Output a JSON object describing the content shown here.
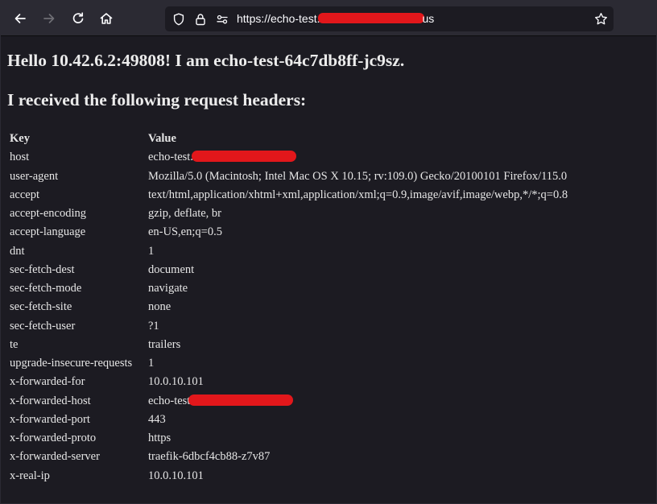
{
  "browser": {
    "url_visible_prefix": "https://echo-test.",
    "url_visible_suffix": "us",
    "icons": {
      "back": "arrow-left-icon",
      "forward": "arrow-right-icon",
      "reload": "reload-icon",
      "home": "home-icon",
      "tracking": "shield-icon",
      "lock": "lock-icon",
      "permissions": "permissions-icon",
      "bookmark": "star-icon"
    },
    "colors": {
      "toolbar": "#2b2a33",
      "urlbar": "#1c1b22",
      "page_bg": "#1c1b22",
      "redaction": "#e2171b"
    }
  },
  "page": {
    "greeting": "Hello 10.42.6.2:49808! I am echo-test-64c7db8ff-jc9sz.",
    "subheading": "I received the following request headers:",
    "table": {
      "columns": [
        "Key",
        "Value"
      ],
      "rows": [
        {
          "key": "host",
          "value": "echo-test.",
          "redacted": true
        },
        {
          "key": "user-agent",
          "value": "Mozilla/5.0 (Macintosh; Intel Mac OS X 10.15; rv:109.0) Gecko/20100101 Firefox/115.0"
        },
        {
          "key": "accept",
          "value": "text/html,application/xhtml+xml,application/xml;q=0.9,image/avif,image/webp,*/*;q=0.8"
        },
        {
          "key": "accept-encoding",
          "value": "gzip, deflate, br"
        },
        {
          "key": "accept-language",
          "value": "en-US,en;q=0.5"
        },
        {
          "key": "dnt",
          "value": "1"
        },
        {
          "key": "sec-fetch-dest",
          "value": "document"
        },
        {
          "key": "sec-fetch-mode",
          "value": "navigate"
        },
        {
          "key": "sec-fetch-site",
          "value": "none"
        },
        {
          "key": "sec-fetch-user",
          "value": "?1"
        },
        {
          "key": "te",
          "value": "trailers"
        },
        {
          "key": "upgrade-insecure-requests",
          "value": "1"
        },
        {
          "key": "x-forwarded-for",
          "value": "10.0.10.101"
        },
        {
          "key": "x-forwarded-host",
          "value": "echo-test",
          "redacted": true
        },
        {
          "key": "x-forwarded-port",
          "value": "443"
        },
        {
          "key": "x-forwarded-proto",
          "value": "https"
        },
        {
          "key": "x-forwarded-server",
          "value": "traefik-6dbcf4cb88-z7v87"
        },
        {
          "key": "x-real-ip",
          "value": "10.0.10.101"
        }
      ]
    }
  }
}
